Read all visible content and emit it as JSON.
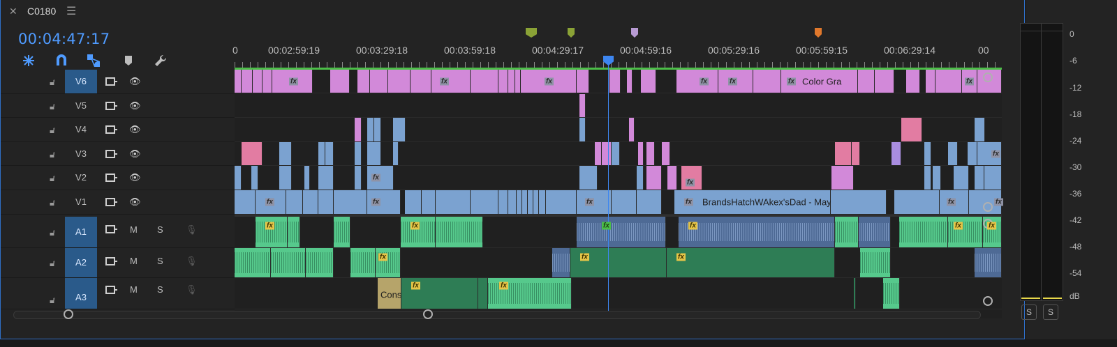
{
  "panel": {
    "sequence_name": "C0180",
    "timecode": "00:04:47:17"
  },
  "ruler": {
    "labels": [
      "0",
      "00:02:59:19",
      "00:03:29:18",
      "00:03:59:18",
      "00:04:29:17",
      "00:04:59:16",
      "00:05:29:16",
      "00:05:59:15",
      "00:06:29:14",
      "00"
    ],
    "marker_colors": [
      "#8aa236",
      "#8aa236",
      "#b79ad2",
      "#e0782c"
    ]
  },
  "video_tracks": [
    {
      "name": "V6",
      "targeted": true
    },
    {
      "name": "V5",
      "targeted": false
    },
    {
      "name": "V4",
      "targeted": false
    },
    {
      "name": "V3",
      "targeted": false
    },
    {
      "name": "V2",
      "targeted": false
    },
    {
      "name": "V1",
      "targeted": false
    }
  ],
  "audio_tracks": [
    {
      "name": "A1",
      "targeted": true
    },
    {
      "name": "A2",
      "targeted": true
    },
    {
      "name": "A3",
      "targeted": true
    }
  ],
  "track_controls": {
    "mute": "M",
    "solo": "S"
  },
  "clips": {
    "fx": "fx",
    "v6_label": "Color Gra",
    "v1_label": "BrandsHatchWAkex'sDad - May",
    "a3_label": "Cons"
  },
  "meter": {
    "scale": [
      "0",
      "-6",
      "-12",
      "-18",
      "-24",
      "-30",
      "-36",
      "-42",
      "-48",
      "-54",
      "dB"
    ],
    "solo_left": "S",
    "solo_right": "S"
  },
  "colors": {
    "timecode": "#4f9bff",
    "v6_clip": "#d289d9",
    "v1_clip": "#7ba2d0",
    "audio_clip": "#56c98c",
    "playhead": "#3d86f0",
    "track_target": "#2a5a8a"
  }
}
